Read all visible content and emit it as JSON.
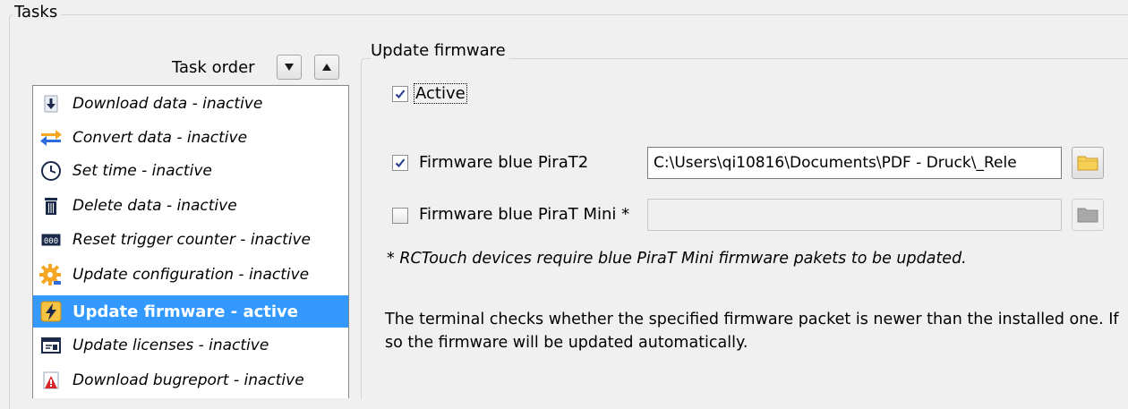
{
  "tasks_group": {
    "title": "Tasks"
  },
  "task_order": {
    "label": "Task order",
    "down_icon": "triangle-down-icon",
    "up_icon": "triangle-up-icon"
  },
  "task_list": [
    {
      "label": "Download data - inactive",
      "icon": "download-icon"
    },
    {
      "label": "Convert data - inactive",
      "icon": "convert-arrows-icon"
    },
    {
      "label": "Set time - inactive",
      "icon": "clock-icon"
    },
    {
      "label": "Delete data - inactive",
      "icon": "trash-icon"
    },
    {
      "label": "Reset trigger counter - inactive",
      "icon": "counter-icon"
    },
    {
      "label": "Update configuration - inactive",
      "icon": "gear-icon"
    },
    {
      "label": "Update firmware - active",
      "icon": "firmware-lightning-icon",
      "selected": true
    },
    {
      "label": "Update licenses - inactive",
      "icon": "license-icon"
    },
    {
      "label": "Download bugreport - inactive",
      "icon": "bugreport-icon"
    }
  ],
  "firmware_panel": {
    "title": "Update firmware",
    "active": {
      "label": "Active",
      "checked": true
    },
    "pirat2": {
      "label": "Firmware blue PiraT2",
      "checked": true,
      "path": "C:\\Users\\qi10816\\Documents\\PDF - Druck\\_Rele"
    },
    "pirat_mini": {
      "label": "Firmware blue PiraT Mini *",
      "checked": false,
      "path": ""
    },
    "note": "* RCTouch devices require blue PiraT Mini firmware pakets to be updated.",
    "description": "The terminal checks whether the specified firmware packet is newer than the installed one. If so the firmware will be updated automatically."
  },
  "colors": {
    "selection": "#3399ff",
    "background": "#f0f0f0",
    "folder_yellow": "#f4c842"
  }
}
